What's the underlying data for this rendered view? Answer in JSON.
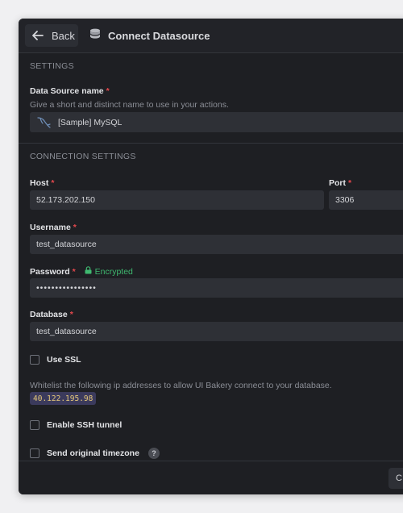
{
  "header": {
    "back_label": "Back",
    "title": "Connect Datasource"
  },
  "settings": {
    "section_title": "SETTINGS",
    "name_label": "Data Source name",
    "name_hint": "Give a short and distinct name to use in your actions.",
    "name_value": "[Sample] MySQL"
  },
  "connection": {
    "section_title": "CONNECTION SETTINGS",
    "host_label": "Host",
    "host_value": "52.173.202.150",
    "port_label": "Port",
    "port_value": "3306",
    "username_label": "Username",
    "username_value": "test_datasource",
    "password_label": "Password",
    "password_status": "Encrypted",
    "password_value": "••••••••••••••••",
    "database_label": "Database",
    "database_value": "test_datasource",
    "use_ssl_label": "Use SSL",
    "use_ssl_checked": false,
    "whitelist_hint": "Whitelist the following ip addresses to allow UI Bakery connect to your database.",
    "whitelist_ip": "40.122.195.98",
    "ssh_label": "Enable SSH tunnel",
    "ssh_checked": false,
    "timezone_label": "Send original timezone",
    "timezone_checked": false,
    "timezone_help": "?"
  },
  "required_marker": "*",
  "footer": {
    "button_label": "C"
  },
  "icons": {
    "back": "arrow-left-icon",
    "title": "database-icon",
    "datasource": "mysql-dolphin-icon",
    "encrypted": "lock-icon",
    "help": "question-icon"
  },
  "colors": {
    "background": "#1e1f23",
    "input": "#2e3036",
    "required": "#e5484d",
    "encrypted": "#3fb970",
    "ip_badge_bg": "#3b3a5c",
    "ip_badge_text": "#e6c87a"
  }
}
